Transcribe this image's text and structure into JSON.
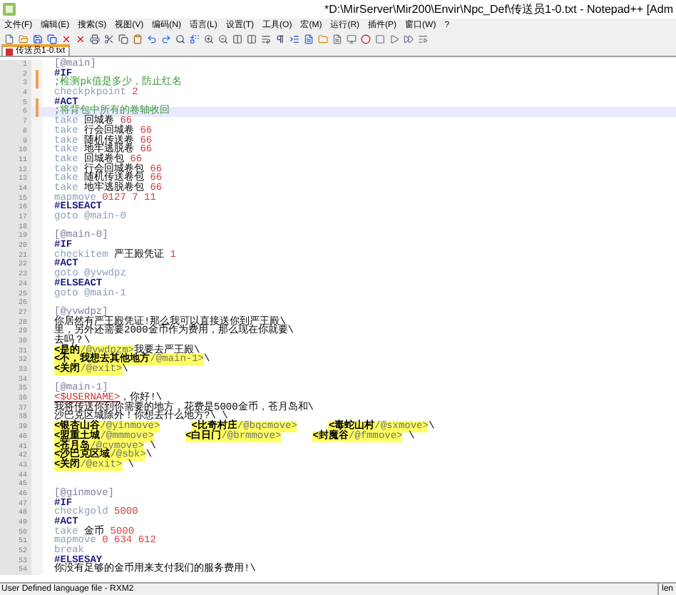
{
  "window": {
    "title": "*D:\\MirServer\\Mir200\\Envir\\Npc_Def\\传送员1-0.txt - Notepad++ [Adm"
  },
  "menu": [
    "文件(F)",
    "编辑(E)",
    "搜索(S)",
    "视图(V)",
    "编码(N)",
    "语言(L)",
    "设置(T)",
    "工具(O)",
    "宏(M)",
    "运行(R)",
    "插件(P)",
    "窗口(W)",
    "?"
  ],
  "tabs": [
    {
      "label": "传送员1-0.txt",
      "selected": true
    }
  ],
  "lines": [
    {
      "number": "1",
      "current": false,
      "changed": false,
      "tokens": [
        {
          "kind": "label",
          "text": "[@main]"
        }
      ]
    },
    {
      "number": "2",
      "current": false,
      "changed": true,
      "tokens": [
        {
          "kind": "kw",
          "text": "#IF"
        }
      ]
    },
    {
      "number": "3",
      "current": false,
      "changed": true,
      "tokens": [
        {
          "kind": "comment",
          "text": ";检测pk值是多少，防止红名"
        }
      ]
    },
    {
      "number": "4",
      "current": false,
      "changed": false,
      "tokens": [
        {
          "kind": "cmd",
          "text": "checkpkpoint "
        },
        {
          "kind": "num",
          "text": "2"
        }
      ]
    },
    {
      "number": "5",
      "current": false,
      "changed": true,
      "tokens": [
        {
          "kind": "kw",
          "text": "#ACT"
        }
      ]
    },
    {
      "number": "6",
      "current": true,
      "changed": true,
      "tokens": [
        {
          "kind": "comment",
          "text": ";将背包中所有的卷轴收回"
        }
      ]
    },
    {
      "number": "7",
      "current": false,
      "changed": false,
      "tokens": [
        {
          "kind": "cmd",
          "text": "take "
        },
        {
          "kind": "text",
          "text": "回城卷 "
        },
        {
          "kind": "num",
          "text": "66"
        }
      ]
    },
    {
      "number": "8",
      "current": false,
      "changed": false,
      "tokens": [
        {
          "kind": "cmd",
          "text": "take "
        },
        {
          "kind": "text",
          "text": "行会回城卷 "
        },
        {
          "kind": "num",
          "text": "66"
        }
      ]
    },
    {
      "number": "9",
      "current": false,
      "changed": false,
      "tokens": [
        {
          "kind": "cmd",
          "text": "take "
        },
        {
          "kind": "text",
          "text": "随机传送卷 "
        },
        {
          "kind": "num",
          "text": "66"
        }
      ]
    },
    {
      "number": "10",
      "current": false,
      "changed": false,
      "tokens": [
        {
          "kind": "cmd",
          "text": "take "
        },
        {
          "kind": "text",
          "text": "地牢逃脱卷 "
        },
        {
          "kind": "num",
          "text": "66"
        }
      ]
    },
    {
      "number": "11",
      "current": false,
      "changed": false,
      "tokens": [
        {
          "kind": "cmd",
          "text": "take "
        },
        {
          "kind": "text",
          "text": "回城卷包 "
        },
        {
          "kind": "num",
          "text": "66"
        }
      ]
    },
    {
      "number": "12",
      "current": false,
      "changed": false,
      "tokens": [
        {
          "kind": "cmd",
          "text": "take "
        },
        {
          "kind": "text",
          "text": "行会回城卷包 "
        },
        {
          "kind": "num",
          "text": "66"
        }
      ]
    },
    {
      "number": "13",
      "current": false,
      "changed": false,
      "tokens": [
        {
          "kind": "cmd",
          "text": "take "
        },
        {
          "kind": "text",
          "text": "随机传送卷包 "
        },
        {
          "kind": "num",
          "text": "66"
        }
      ]
    },
    {
      "number": "14",
      "current": false,
      "changed": false,
      "tokens": [
        {
          "kind": "cmd",
          "text": "take "
        },
        {
          "kind": "text",
          "text": "地牢逃脱卷包 "
        },
        {
          "kind": "num",
          "text": "66"
        }
      ]
    },
    {
      "number": "15",
      "current": false,
      "changed": false,
      "tokens": [
        {
          "kind": "cmd",
          "text": "mapmove "
        },
        {
          "kind": "num",
          "text": "0127 7 11"
        }
      ]
    },
    {
      "number": "16",
      "current": false,
      "changed": false,
      "tokens": [
        {
          "kind": "kw",
          "text": "#ELSEACT"
        }
      ]
    },
    {
      "number": "17",
      "current": false,
      "changed": false,
      "tokens": [
        {
          "kind": "cmd",
          "text": "goto @main-0"
        }
      ]
    },
    {
      "number": "18",
      "current": false,
      "changed": false
    },
    {
      "number": "19",
      "current": false,
      "changed": false,
      "tokens": [
        {
          "kind": "label",
          "text": "[@main-0]"
        }
      ]
    },
    {
      "number": "20",
      "current": false,
      "changed": false,
      "tokens": [
        {
          "kind": "kw",
          "text": "#IF"
        }
      ]
    },
    {
      "number": "21",
      "current": false,
      "changed": false,
      "tokens": [
        {
          "kind": "cmd",
          "text": "checkitem "
        },
        {
          "kind": "text",
          "text": "严王殿凭证 "
        },
        {
          "kind": "num",
          "text": "1"
        }
      ]
    },
    {
      "number": "22",
      "current": false,
      "changed": false,
      "tokens": [
        {
          "kind": "kw",
          "text": "#ACT"
        }
      ]
    },
    {
      "number": "23",
      "current": false,
      "changed": false,
      "tokens": [
        {
          "kind": "cmd",
          "text": "goto @yvwdpz"
        }
      ]
    },
    {
      "number": "24",
      "current": false,
      "changed": false,
      "tokens": [
        {
          "kind": "kw",
          "text": "#ELSEACT"
        }
      ]
    },
    {
      "number": "25",
      "current": false,
      "changed": false,
      "tokens": [
        {
          "kind": "cmd",
          "text": "goto @main-1"
        }
      ]
    },
    {
      "number": "26",
      "current": false,
      "changed": false
    },
    {
      "number": "27",
      "current": false,
      "changed": false,
      "tokens": [
        {
          "kind": "label",
          "text": "[@yvwdpz]"
        }
      ]
    },
    {
      "number": "28",
      "current": false,
      "changed": false,
      "tokens": [
        {
          "kind": "text",
          "text": "你居然有严王殿凭证!那么我可以直接送你到严王殿\\"
        }
      ]
    },
    {
      "number": "29",
      "current": false,
      "changed": false,
      "tokens": [
        {
          "kind": "text",
          "text": "里，另外还需要2000金币作为费用，那么现在你就要\\"
        }
      ]
    },
    {
      "number": "30",
      "current": false,
      "changed": false,
      "tokens": [
        {
          "kind": "text",
          "text": "去吗？\\"
        }
      ]
    },
    {
      "number": "31",
      "current": false,
      "changed": false,
      "tokens": [
        {
          "kind": "link",
          "text": "<是的"
        },
        {
          "kind": "arg",
          "text": "/@ywdpzm>"
        },
        {
          "kind": "text",
          "text": "我要去严王殿\\"
        }
      ]
    },
    {
      "number": "32",
      "current": false,
      "changed": false,
      "tokens": [
        {
          "kind": "link",
          "text": "<不，我想去其他地方"
        },
        {
          "kind": "arg",
          "text": "/@main-1>"
        },
        {
          "kind": "text",
          "text": "\\"
        }
      ]
    },
    {
      "number": "33",
      "current": false,
      "changed": false,
      "tokens": [
        {
          "kind": "link",
          "text": "<关闭"
        },
        {
          "kind": "arg",
          "text": "/@exit>"
        },
        {
          "kind": "text",
          "text": "\\"
        }
      ]
    },
    {
      "number": "34",
      "current": false,
      "changed": false
    },
    {
      "number": "35",
      "current": false,
      "changed": false,
      "tokens": [
        {
          "kind": "label",
          "text": "[@main-1]"
        }
      ]
    },
    {
      "number": "36",
      "current": false,
      "changed": false,
      "tokens": [
        {
          "kind": "var",
          "text": "<$USERNAME>"
        },
        {
          "kind": "text",
          "text": "，你好!\\"
        }
      ]
    },
    {
      "number": "37",
      "current": false,
      "changed": false,
      "tokens": [
        {
          "kind": "text",
          "text": "我将传送你到你需要的地方，花费是5000金币，苍月岛和\\"
        }
      ]
    },
    {
      "number": "38",
      "current": false,
      "changed": false,
      "tokens": [
        {
          "kind": "text",
          "text": "沙巴克区城除外！你想去什么地方?\\ \\"
        }
      ]
    },
    {
      "number": "39",
      "current": false,
      "changed": false,
      "tokens": [
        {
          "kind": "link",
          "text": "<银杏山谷"
        },
        {
          "kind": "arg",
          "text": "/@yinmove>"
        },
        {
          "kind": "gap"
        },
        {
          "kind": "link",
          "text": "<比奇村庄"
        },
        {
          "kind": "arg",
          "text": "/@bqcmove>"
        },
        {
          "kind": "gap"
        },
        {
          "kind": "link",
          "text": "<毒蛇山村"
        },
        {
          "kind": "arg",
          "text": "/@sxmove>"
        },
        {
          "kind": "text",
          "text": "\\"
        }
      ]
    },
    {
      "number": "40",
      "current": false,
      "changed": false,
      "tokens": [
        {
          "kind": "link",
          "text": "<盟重土城"
        },
        {
          "kind": "arg",
          "text": "/@mmmove>"
        },
        {
          "kind": "gap"
        },
        {
          "kind": "link",
          "text": "<白日门"
        },
        {
          "kind": "arg",
          "text": "/@brmmove>"
        },
        {
          "kind": "gap"
        },
        {
          "kind": "link",
          "text": "<封魔谷"
        },
        {
          "kind": "arg",
          "text": "/@fmmove>"
        },
        {
          "kind": "text",
          "text": " \\"
        }
      ]
    },
    {
      "number": "41",
      "current": false,
      "changed": false,
      "tokens": [
        {
          "kind": "link",
          "text": "<苍月岛"
        },
        {
          "kind": "arg",
          "text": "/@cymove>"
        },
        {
          "kind": "text",
          "text": " \\"
        }
      ]
    },
    {
      "number": "42",
      "current": false,
      "changed": false,
      "tokens": [
        {
          "kind": "link",
          "text": "<沙巴克区域"
        },
        {
          "kind": "arg",
          "text": "/@sbk>"
        },
        {
          "kind": "text",
          "text": "\\"
        }
      ]
    },
    {
      "number": "43",
      "current": false,
      "changed": false,
      "tokens": [
        {
          "kind": "link",
          "text": "<关闭"
        },
        {
          "kind": "arg",
          "text": "/@exit>"
        },
        {
          "kind": "text",
          "text": " \\"
        }
      ]
    },
    {
      "number": "44",
      "current": false,
      "changed": false
    },
    {
      "number": "45",
      "current": false,
      "changed": false
    },
    {
      "number": "46",
      "current": false,
      "changed": false,
      "tokens": [
        {
          "kind": "label",
          "text": "[@ginmove]"
        }
      ]
    },
    {
      "number": "47",
      "current": false,
      "changed": false,
      "tokens": [
        {
          "kind": "kw",
          "text": "#IF"
        }
      ]
    },
    {
      "number": "48",
      "current": false,
      "changed": false,
      "tokens": [
        {
          "kind": "cmd",
          "text": "checkgold "
        },
        {
          "kind": "num",
          "text": "5000"
        }
      ]
    },
    {
      "number": "49",
      "current": false,
      "changed": false,
      "tokens": [
        {
          "kind": "kw",
          "text": "#ACT"
        }
      ]
    },
    {
      "number": "50",
      "current": false,
      "changed": false,
      "tokens": [
        {
          "kind": "cmd",
          "text": "take "
        },
        {
          "kind": "text",
          "text": "金币 "
        },
        {
          "kind": "num",
          "text": "5000"
        }
      ]
    },
    {
      "number": "51",
      "current": false,
      "changed": false,
      "tokens": [
        {
          "kind": "cmd",
          "text": "mapmove "
        },
        {
          "kind": "num",
          "text": "0 634 612"
        }
      ]
    },
    {
      "number": "52",
      "current": false,
      "changed": false,
      "tokens": [
        {
          "kind": "cmd",
          "text": "break"
        }
      ]
    },
    {
      "number": "53",
      "current": false,
      "changed": false,
      "tokens": [
        {
          "kind": "kw",
          "text": "#ELSESAY"
        }
      ]
    },
    {
      "number": "54",
      "current": false,
      "changed": false,
      "tokens": [
        {
          "kind": "text",
          "text": "你没有足够的金币用来支付我们的服务费用!\\"
        }
      ]
    }
  ],
  "status_bar": {
    "language": "User Defined language file - RXM2",
    "length": "len"
  }
}
